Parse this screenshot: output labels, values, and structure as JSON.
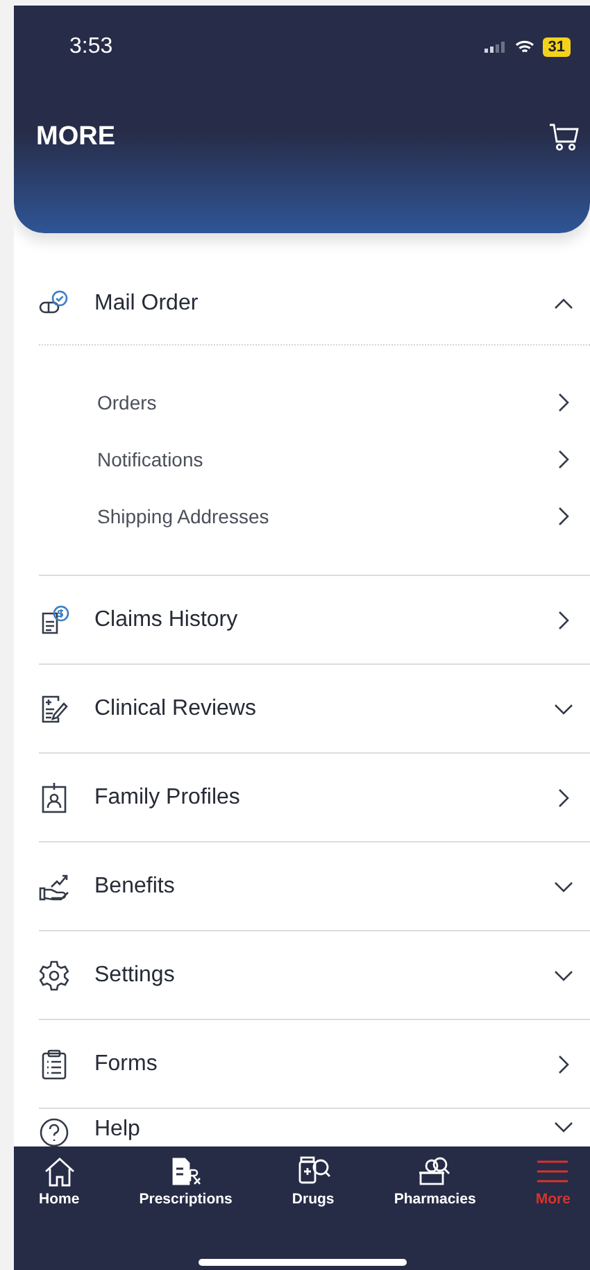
{
  "status_bar": {
    "time": "3:53",
    "battery": "31"
  },
  "header": {
    "title": "MORE"
  },
  "menu": [
    {
      "label": "Mail Order",
      "kind": "group",
      "expanded": true,
      "children": [
        {
          "label": "Orders"
        },
        {
          "label": "Notifications"
        },
        {
          "label": "Shipping Addresses"
        }
      ]
    },
    {
      "label": "Claims History",
      "kind": "link"
    },
    {
      "label": "Clinical Reviews",
      "kind": "group",
      "expanded": false
    },
    {
      "label": "Family Profiles",
      "kind": "link"
    },
    {
      "label": "Benefits",
      "kind": "group",
      "expanded": false
    },
    {
      "label": "Settings",
      "kind": "group",
      "expanded": false
    },
    {
      "label": "Forms",
      "kind": "link"
    },
    {
      "label": "Help",
      "kind": "group",
      "expanded": false
    }
  ],
  "tab_bar": [
    {
      "label": "Home",
      "selected": false
    },
    {
      "label": "Prescriptions",
      "selected": false
    },
    {
      "label": "Drugs",
      "selected": false
    },
    {
      "label": "Pharmacies",
      "selected": false
    },
    {
      "label": "More",
      "selected": true
    }
  ]
}
